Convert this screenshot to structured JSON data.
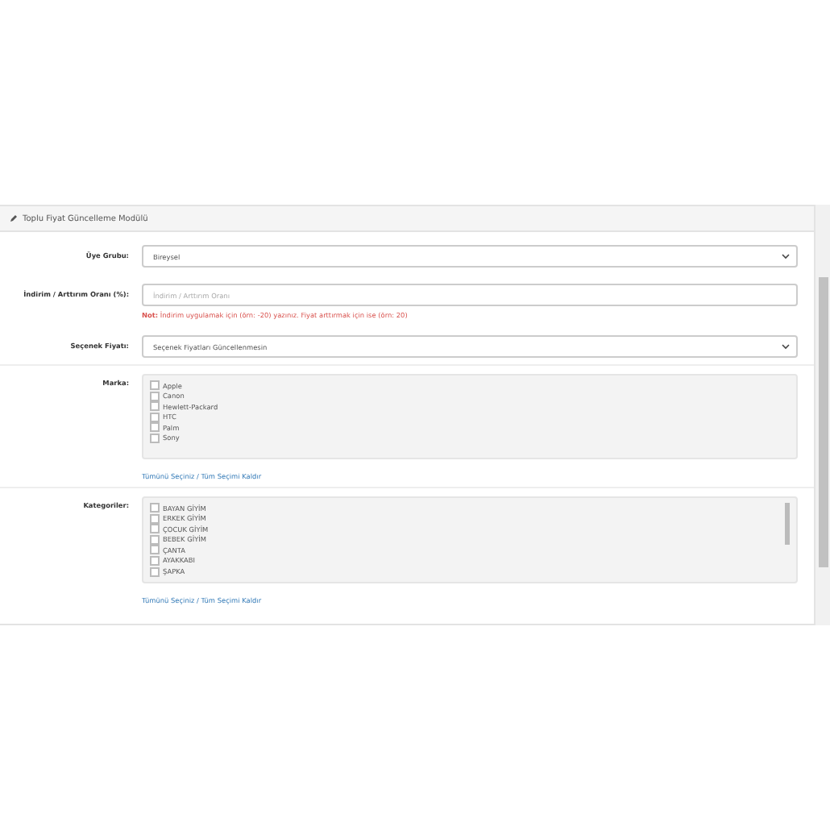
{
  "panel": {
    "title": "Toplu Fiyat Güncelleme Modülü"
  },
  "fields": [
    {
      "kind": "select",
      "label": "Üye Grubu:",
      "value": "Bireysel"
    },
    {
      "kind": "input",
      "label": "İndirim / Arttırım Oranı (%):",
      "placeholder": "İndirim / Arttırım Oranı",
      "note": "**Not:** İndirim uygulamak için (örn: -20) yazınız. Fiyat arttırmak için ise (örn: 20)"
    },
    {
      "kind": "select",
      "label": "Seçenek Fiyatı:",
      "value": "Seçenek Fiyatları Güncellenmesin"
    },
    {
      "kind": "checklist",
      "label": "Marka:",
      "scrollable": false,
      "items": [
        {
          "label": "Apple",
          "checked": false
        },
        {
          "label": "Canon",
          "checked": false
        },
        {
          "label": "Hewlett-Packard",
          "checked": false
        },
        {
          "label": "HTC",
          "checked": false
        },
        {
          "label": "Palm",
          "checked": false
        },
        {
          "label": "Sony",
          "checked": false
        }
      ],
      "link": "Tümünü Seçiniz / Tüm Seçimi Kaldır"
    },
    {
      "kind": "checklist",
      "label": "Kategoriler:",
      "scrollable": true,
      "items": [
        {
          "label": "BAYAN GİYİM",
          "checked": false
        },
        {
          "label": "ERKEK GİYİM",
          "checked": false
        },
        {
          "label": "ÇOCUK GİYİM",
          "checked": false
        },
        {
          "label": "BEBEK GİYİM",
          "checked": false
        },
        {
          "label": "ÇANTA",
          "checked": false
        },
        {
          "label": "AYAKKABI",
          "checked": false
        },
        {
          "label": "ŞAPKA",
          "checked": false
        }
      ],
      "link": "Tümünü Seçiniz / Tüm Seçimi Kaldır"
    }
  ]
}
